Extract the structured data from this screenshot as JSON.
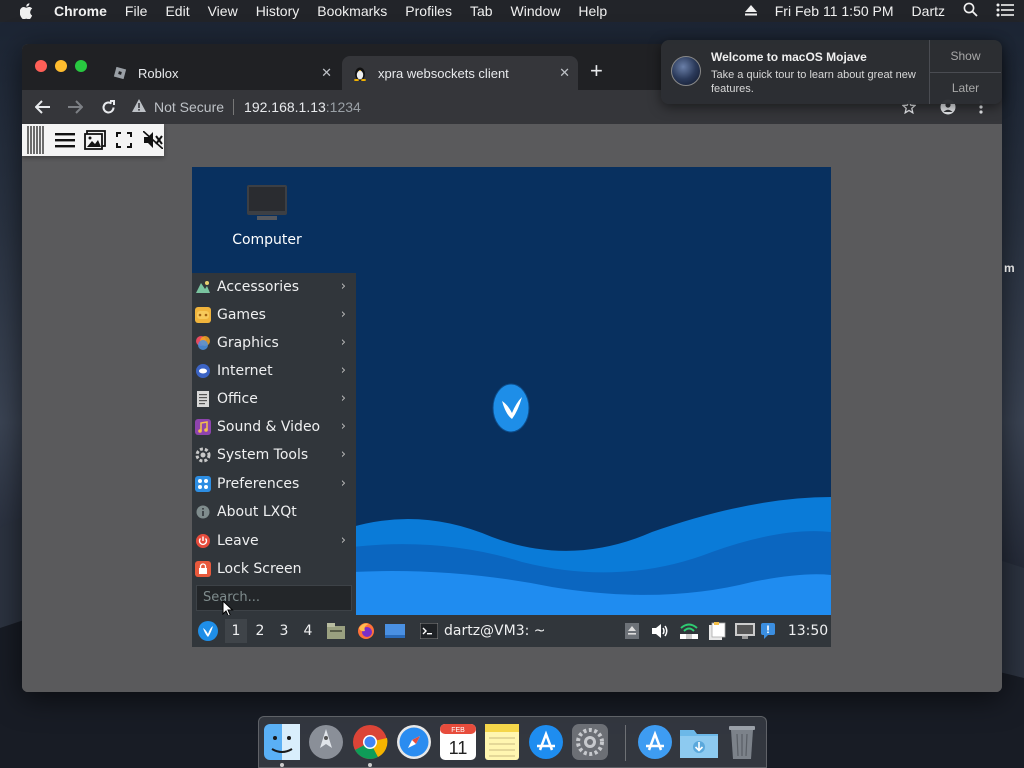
{
  "menubar": {
    "app_name": "Chrome",
    "menus": [
      "File",
      "Edit",
      "View",
      "History",
      "Bookmarks",
      "Profiles",
      "Tab",
      "Window",
      "Help"
    ],
    "clock": "Fri Feb 11  1:50 PM",
    "user": "Dartz"
  },
  "browser": {
    "tabs": [
      {
        "title": "Roblox",
        "active": false
      },
      {
        "title": "xpra websockets client",
        "active": true
      }
    ],
    "address": {
      "security_label": "Not Secure",
      "host": "192.168.1.13",
      "port": ":1234"
    }
  },
  "remote_desktop": {
    "desktop_icon_label": "Computer",
    "menu_items": [
      {
        "label": "Accessories",
        "icon": "accessories-icon",
        "submenu": true
      },
      {
        "label": "Games",
        "icon": "games-icon",
        "submenu": true
      },
      {
        "label": "Graphics",
        "icon": "graphics-icon",
        "submenu": true
      },
      {
        "label": "Internet",
        "icon": "internet-icon",
        "submenu": true
      },
      {
        "label": "Office",
        "icon": "office-icon",
        "submenu": true
      },
      {
        "label": "Sound & Video",
        "icon": "sound-video-icon",
        "submenu": true
      },
      {
        "label": "System Tools",
        "icon": "system-tools-icon",
        "submenu": true
      },
      {
        "label": "Preferences",
        "icon": "preferences-icon",
        "submenu": true
      },
      {
        "label": "About LXQt",
        "icon": "info-icon",
        "submenu": false
      },
      {
        "label": "Leave",
        "icon": "power-icon",
        "submenu": true
      },
      {
        "label": "Lock Screen",
        "icon": "lock-icon",
        "submenu": false
      }
    ],
    "search_placeholder": "Search...",
    "panel": {
      "workspaces": [
        "1",
        "2",
        "3",
        "4"
      ],
      "active_workspace": "1",
      "task_label": "dartz@VM3: ~",
      "clock": "13:50"
    }
  },
  "notification": {
    "title": "Welcome to macOS Mojave",
    "body": "Take a quick tour to learn about great new features.",
    "show_label": "Show",
    "later_label": "Later"
  },
  "calendar_icon": {
    "month": "FEB",
    "day": "11"
  },
  "edge_text": "m"
}
